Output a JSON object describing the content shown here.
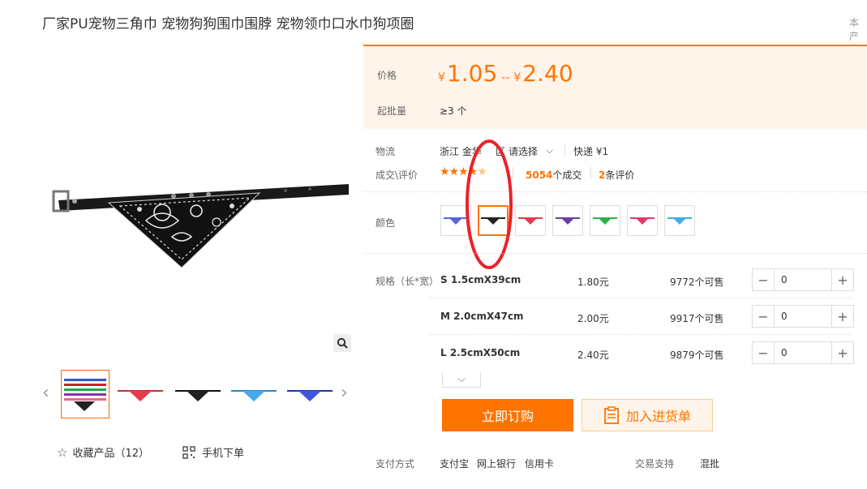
{
  "product": {
    "title": "厂家PU宠物三角巾 宠物狗狗围巾围脖 宠物领巾口水巾狗项圈",
    "corner_text": "本产"
  },
  "gallery": {
    "thumbnails": [
      "multicolor",
      "red",
      "black",
      "blue",
      "navy"
    ],
    "selected_thumbnail": 0,
    "favorite_label": "收藏产品（12）",
    "mobile_order_label": "手机下单"
  },
  "price": {
    "label": "价格",
    "currency": "¥",
    "min": "1.05",
    "range_sep": "--",
    "max": "2.40",
    "moq_label": "起批量",
    "moq_value": "≥3 个"
  },
  "logistics": {
    "label": "物流",
    "origin": "浙江 金华",
    "origin_tail": "区",
    "select_label": "请选择",
    "express": "快递 ¥1"
  },
  "rating": {
    "label": "成交\\评价",
    "stars": 4.5,
    "deals_count": "5054",
    "deals_suffix": "个成交",
    "reviews_count": "2",
    "reviews_suffix": "条评价"
  },
  "color": {
    "label": "颜色",
    "swatches": [
      "purple-blue",
      "black",
      "red",
      "purple",
      "green",
      "pink",
      "light-blue"
    ],
    "swatch_colors": [
      "#5566dd",
      "#222222",
      "#e23b4a",
      "#6a3fa0",
      "#2bb34a",
      "#e23b6a",
      "#44aaee"
    ],
    "selected": 1
  },
  "specs": {
    "label": "规格（长*宽）",
    "rows": [
      {
        "name": "S 1.5cmX39cm",
        "price": "1.80元",
        "stock": "9772个可售",
        "qty": "0"
      },
      {
        "name": "M 2.0cmX47cm",
        "price": "2.00元",
        "stock": "9917个可售",
        "qty": "0"
      },
      {
        "name": "L 2.5cmX50cm",
        "price": "2.40元",
        "stock": "9879个可售",
        "qty": "0"
      }
    ]
  },
  "actions": {
    "buy_now": "立即订购",
    "add_to_list": "加入进货单"
  },
  "payment": {
    "label": "支付方式",
    "methods": [
      "支付宝",
      "网上银行",
      "信用卡"
    ],
    "trade_label": "交易支持",
    "trade_value": "混批"
  },
  "colors": {
    "accent": "#ff7300",
    "price_bg": "#fff4e9",
    "annotation": "#e8222a"
  }
}
